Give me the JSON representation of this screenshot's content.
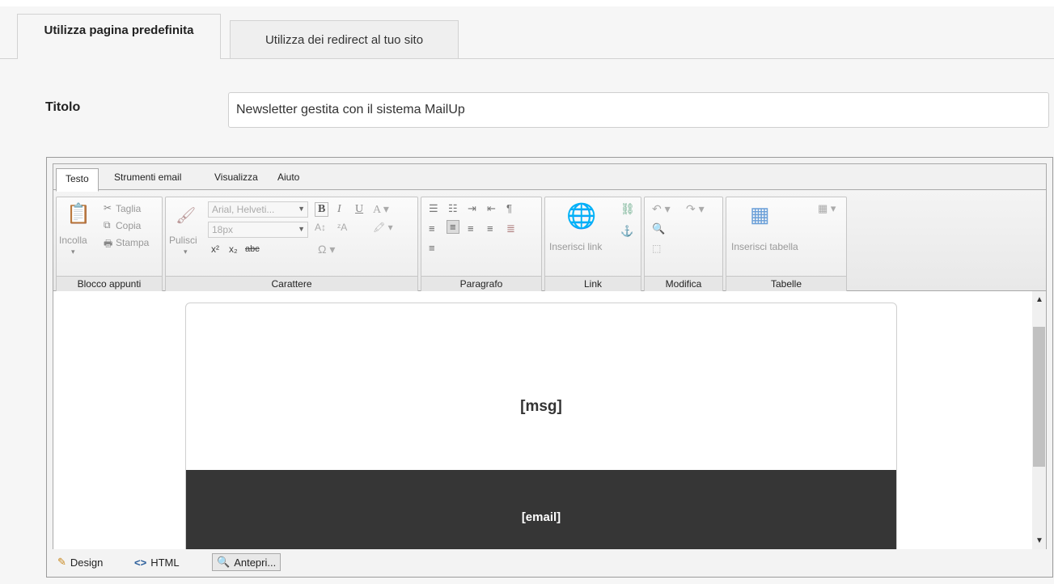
{
  "page_tabs": [
    "Utilizza pagina predefinita",
    "Utilizza dei redirect al tuo sito"
  ],
  "title_label": "Titolo",
  "title_value": "Newsletter gestita con il sistema MailUp",
  "ribbon": {
    "tabs": [
      "Testo",
      "Strumenti email",
      "Visualizza",
      "Aiuto"
    ],
    "clipboard": {
      "paste": "Incolla",
      "cut": "Taglia",
      "copy": "Copia",
      "print": "Stampa",
      "label": "Blocco appunti"
    },
    "font": {
      "clear": "Pulisci",
      "family": "Arial, Helveti...",
      "size": "18px",
      "label": "Carattere"
    },
    "paragraph_label": "Paragrafo",
    "link": {
      "insert": "Inserisci link",
      "label": "Link"
    },
    "edit_label": "Modifica",
    "tables": {
      "insert": "Inserisci tabella",
      "label": "Tabelle"
    }
  },
  "content": {
    "msg": "[msg]",
    "email": "[email]"
  },
  "modes": [
    "Design",
    "HTML",
    "Antepri..."
  ]
}
